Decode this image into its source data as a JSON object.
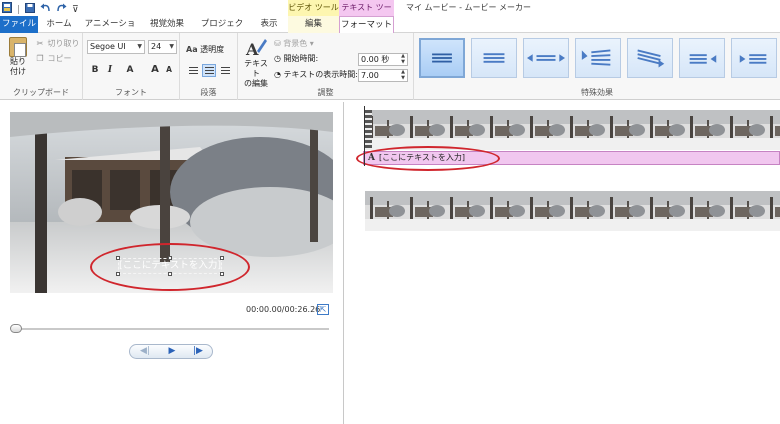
{
  "titlebar": {
    "qat_icons": [
      "app-icon",
      "save-icon",
      "undo-icon",
      "redo-icon",
      "customize-icon"
    ],
    "context_video_tools": "ビデオ ツール",
    "context_text_tools": "テキスト ツール",
    "window_title": "マイ ムービー - ムービー メーカー"
  },
  "tabs": {
    "file": "ファイル",
    "home": "ホーム",
    "animation": "アニメーション",
    "visual_effects": "視覚効果",
    "project": "プロジェクト",
    "view": "表示",
    "edit": "編集",
    "format": "フォーマット"
  },
  "ribbon": {
    "clipboard": {
      "label": "クリップボード",
      "paste": "貼り\n付け",
      "cut": "切り取り",
      "copy": "コピー"
    },
    "font": {
      "label": "フォント",
      "family": "Segoe UI",
      "size": "24",
      "bold": "B",
      "italic": "I",
      "font_color": "A",
      "grow": "A",
      "shrink": "A"
    },
    "paragraph": {
      "label": "段落",
      "transparency": "透明度",
      "transparency_icon": "Aa"
    },
    "adjust": {
      "label": "調整",
      "edit_text": "テキスト\nの編集",
      "background_color": "背景色",
      "start_time_label": "開始時間:",
      "start_time_value": "0.00 秒",
      "text_duration_label": "テキストの表示時間:",
      "text_duration_value": "7.00"
    },
    "effects": {
      "label": "特殊効果",
      "items": [
        "effect-none",
        "effect-plain",
        "effect-fly-sides",
        "effect-swing",
        "effect-slide",
        "effect-fly-left",
        "effect-fly-right",
        "effect-extra"
      ]
    }
  },
  "preview": {
    "overlay_text": "[ここにテキストを入力]",
    "time_display": "00:00.00/00:26.26",
    "seek_progress": 0.0
  },
  "transport": {
    "prev_icon": "◀|",
    "play_icon": "▶",
    "next_icon": "|▶"
  },
  "storyboard": {
    "caption_icon": "A",
    "caption_text": "[ここにテキストを入力]"
  },
  "colors": {
    "file_tab": "#1d6fc9",
    "video_tools": "#fdf6b0",
    "text_tools": "#f4c7f0",
    "caption_bar": "#f1c7ef",
    "highlight_ellipse": "#d0262d"
  }
}
